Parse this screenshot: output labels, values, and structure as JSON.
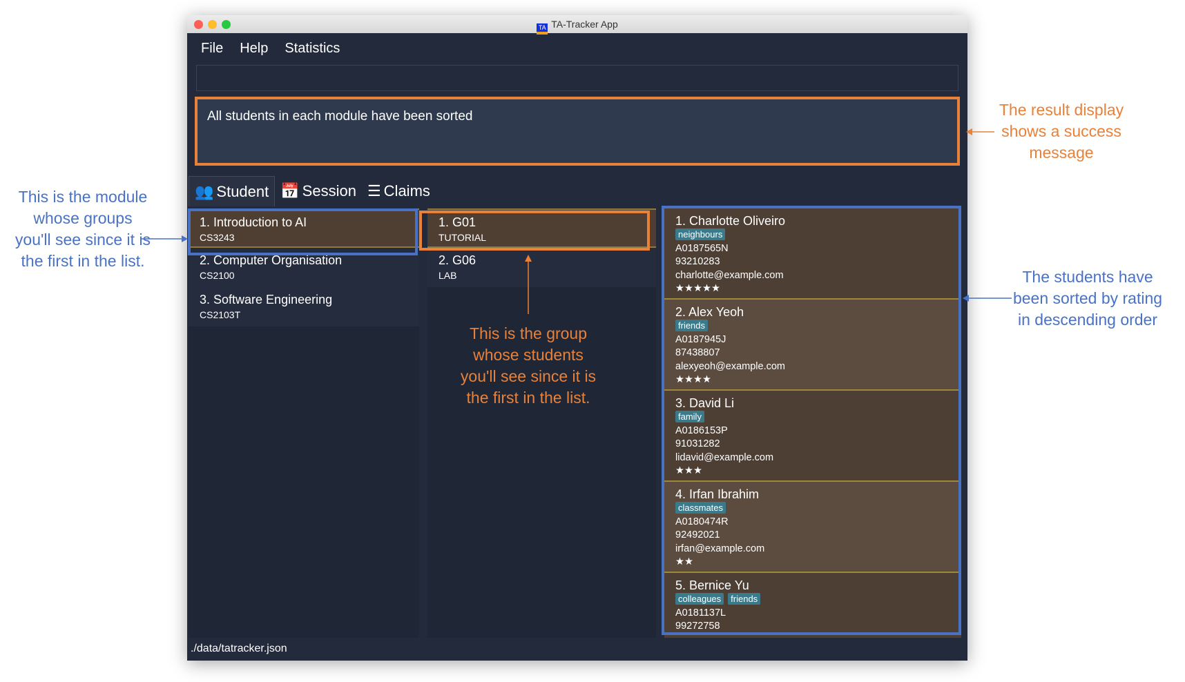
{
  "window": {
    "title": "TA-Tracker App",
    "icon_text": "TA"
  },
  "menu": [
    "File",
    "Help",
    "Statistics"
  ],
  "command_box": {
    "value": "",
    "placeholder": ""
  },
  "result_display": "All students in each module have been sorted",
  "tabs": [
    {
      "label": "Student",
      "icon": "users-icon"
    },
    {
      "label": "Session",
      "icon": "calendar-clock-icon"
    },
    {
      "label": "Claims",
      "icon": "list-icon"
    }
  ],
  "modules": [
    {
      "name": "1.  Introduction to AI",
      "code": "CS3243"
    },
    {
      "name": "2.  Computer Organisation",
      "code": "CS2100"
    },
    {
      "name": "3.  Software Engineering",
      "code": "CS2103T"
    }
  ],
  "groups": [
    {
      "name": "1.  G01",
      "type": "TUTORIAL"
    },
    {
      "name": "2.  G06",
      "type": "LAB"
    }
  ],
  "students": [
    {
      "name": "1.  Charlotte Oliveiro",
      "tags": [
        "neighbours"
      ],
      "id": "A0187565N",
      "phone": "93210283",
      "email": "charlotte@example.com",
      "rating": "★★★★★"
    },
    {
      "name": "2.  Alex Yeoh",
      "tags": [
        "friends"
      ],
      "id": "A0187945J",
      "phone": "87438807",
      "email": "alexyeoh@example.com",
      "rating": "★★★★"
    },
    {
      "name": "3.  David Li",
      "tags": [
        "family"
      ],
      "id": "A0186153P",
      "phone": "91031282",
      "email": "lidavid@example.com",
      "rating": "★★★"
    },
    {
      "name": "4.  Irfan Ibrahim",
      "tags": [
        "classmates"
      ],
      "id": "A0180474R",
      "phone": "92492021",
      "email": "irfan@example.com",
      "rating": "★★"
    },
    {
      "name": "5.  Bernice Yu",
      "tags": [
        "colleagues",
        "friends"
      ],
      "id": "A0181137L",
      "phone": "99272758",
      "email": "",
      "rating": ""
    }
  ],
  "status_bar": "./data/tatracker.json",
  "annotations": {
    "module": "This is the module whose groups you'll see since it is the first in the list.",
    "result": "The result display shows a success message",
    "group": "This is the group whose students you'll see since it is the first in the list.",
    "students": "The students have been sorted by rating in descending order"
  },
  "colors": {
    "orange": "#e8813a",
    "blue": "#4a72c4",
    "background": "#232a3b",
    "selected": "#4f3f33",
    "tag": "#3b7a8a"
  }
}
